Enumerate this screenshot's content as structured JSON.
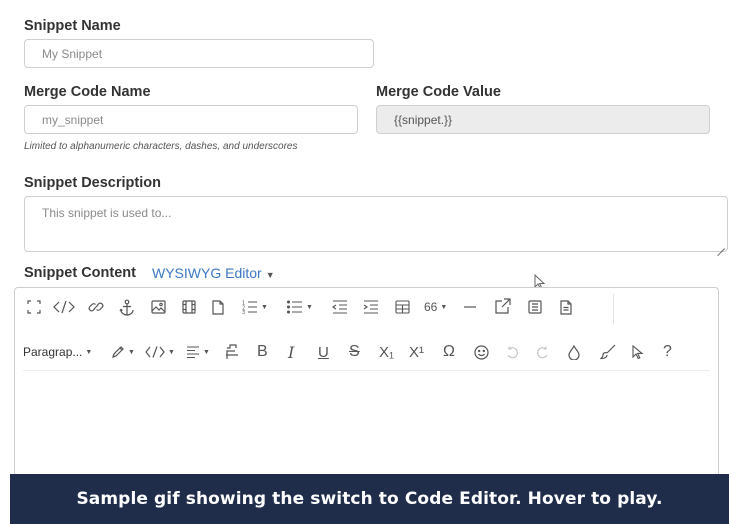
{
  "form": {
    "snippet_name_label": "Snippet Name",
    "snippet_name_placeholder": "My Snippet",
    "merge_code_name_label": "Merge Code Name",
    "merge_code_name_placeholder": "my_snippet",
    "merge_code_hint": "Limited to alphanumeric characters, dashes, and underscores",
    "merge_code_value_label": "Merge Code Value",
    "merge_code_value": "{{snippet.}}",
    "description_label": "Snippet Description",
    "description_placeholder": "This snippet is used to...",
    "content_label": "Snippet Content",
    "editor_mode": "WYSIWYG Editor"
  },
  "toolbar": {
    "heading_level": "66",
    "paragraph_format": "Paragrap...",
    "help": "?",
    "subscript_label": "X₁",
    "superscript_label": "X¹",
    "omega": "Ω",
    "bold": "B",
    "italic": "I",
    "underline": "U",
    "strike": "S"
  },
  "banner": {
    "text": "Sample gif showing the switch to Code Editor. Hover to play."
  },
  "colors": {
    "link": "#3c78c3",
    "banner_bg": "#1f2d4b",
    "readonly_bg": "#ececec"
  }
}
